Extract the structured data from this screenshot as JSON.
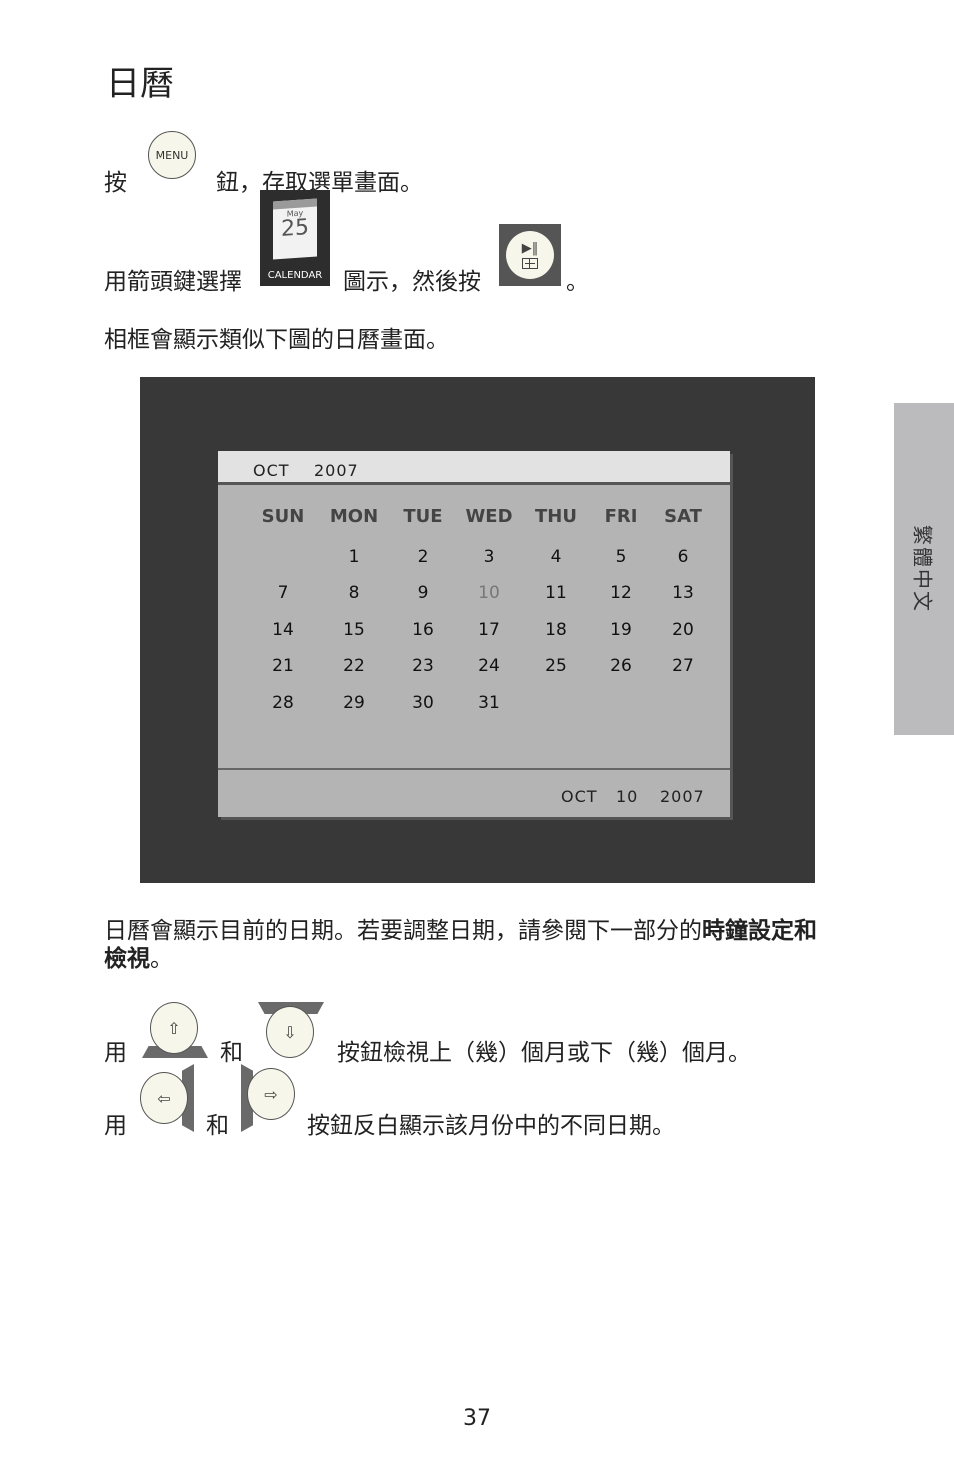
{
  "page": {
    "title": "日曆",
    "page_number": "37",
    "side_tab": "繁體中文"
  },
  "step1": {
    "prefix": "按",
    "suffix": "鈕，存取選單畫面。",
    "menu_button_label": "MENU"
  },
  "step2": {
    "prefix": "用箭頭鍵選擇",
    "middle": "圖示，然後按",
    "suffix": "。",
    "calendar_icon": {
      "month": "May",
      "day": "25",
      "label": "CALENDAR"
    },
    "play_button_icon": "play-pause-icon"
  },
  "step3": {
    "text": "相框會顯示類似下圖的日曆畫面。"
  },
  "calendar_screen": {
    "header_month": "OCT",
    "header_year": "2007",
    "weekdays": [
      "SUN",
      "MON",
      "TUE",
      "WED",
      "THU",
      "FRI",
      "SAT"
    ],
    "weeks": [
      [
        "",
        "1",
        "2",
        "3",
        "4",
        "5",
        "6"
      ],
      [
        "7",
        "8",
        "9",
        "10",
        "11",
        "12",
        "13"
      ],
      [
        "14",
        "15",
        "16",
        "17",
        "18",
        "19",
        "20"
      ],
      [
        "21",
        "22",
        "23",
        "24",
        "25",
        "26",
        "27"
      ],
      [
        "28",
        "29",
        "30",
        "31",
        "",
        "",
        ""
      ]
    ],
    "highlighted_day": "10",
    "footer": {
      "month": "OCT",
      "day": "10",
      "year": "2007"
    }
  },
  "note": {
    "text": "日曆會顯示目前的日期。若要調整日期，請參閱下一部分的",
    "bold": "時鐘設定和檢視",
    "end": "。"
  },
  "nav1": {
    "prefix": "用",
    "and": "和",
    "suffix": "按鈕檢視上（幾）個月或下（幾）個月。",
    "up_glyph": "⇧",
    "down_glyph": "⇩"
  },
  "nav2": {
    "prefix": "用",
    "and": "和",
    "suffix": "按鈕反白顯示該月份中的不同日期。",
    "left_glyph": "⇦",
    "right_glyph": "⇨"
  }
}
